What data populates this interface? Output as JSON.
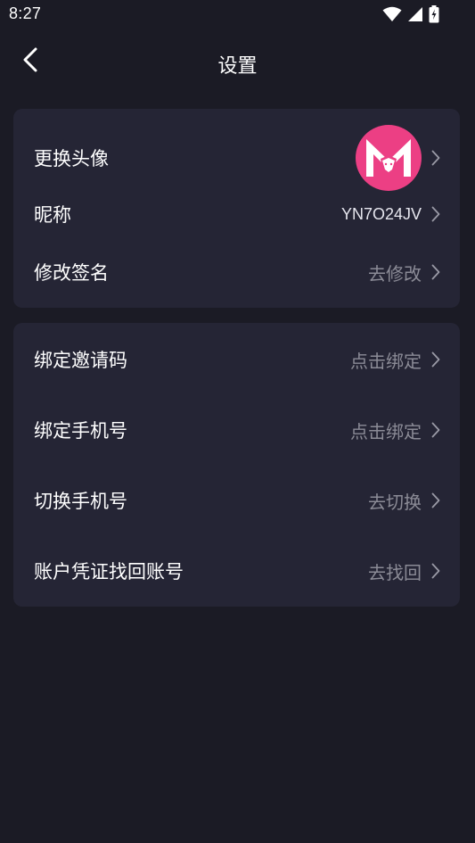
{
  "status_bar": {
    "time": "8:27",
    "icons": [
      "wifi-icon",
      "signal-icon",
      "battery-charging-icon"
    ]
  },
  "nav": {
    "title": "设置",
    "back_icon": "chevron-left-icon"
  },
  "profile_section": {
    "avatar_row": {
      "label": "更换头像"
    },
    "nickname_row": {
      "label": "昵称",
      "value": "YN7O24JV"
    },
    "signature_row": {
      "label": "修改签名",
      "value": "去修改"
    }
  },
  "account_section": {
    "items": [
      {
        "label": "绑定邀请码",
        "value": "点击绑定"
      },
      {
        "label": "绑定手机号",
        "value": "点击绑定"
      },
      {
        "label": "切换手机号",
        "value": "去切换"
      },
      {
        "label": "账户凭证找回账号",
        "value": "去找回"
      }
    ]
  },
  "colors": {
    "background": "#1b1b25",
    "card": "#252535",
    "avatar_brand": "#ec3f84",
    "secondary_text": "#8b8b96"
  }
}
